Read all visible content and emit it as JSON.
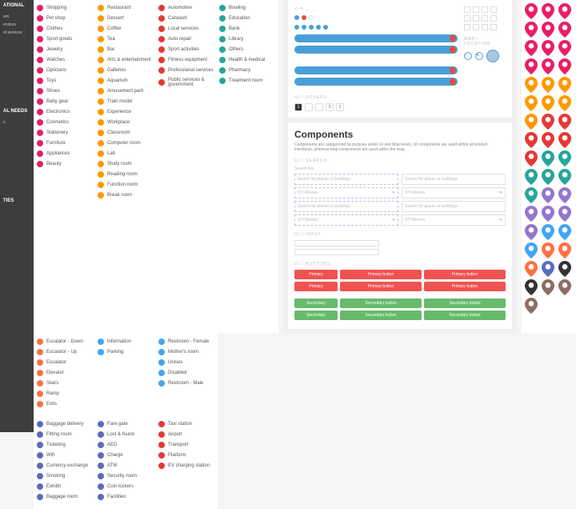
{
  "sidebar": [
    {
      "title": "ATIONAL",
      "items": [
        "ent",
        "ervices",
        "of services"
      ]
    },
    {
      "title": "AL NEEDS",
      "items": [
        "s"
      ]
    },
    {
      "title": "TIES",
      "items": [
        ""
      ]
    }
  ],
  "groups": [
    {
      "color": "#e91e63",
      "items": [
        "Shopping",
        "Pet shop",
        "Clothes",
        "Sport goods",
        "Jewelry",
        "Watches",
        "Opticians",
        "Toys",
        "Shoes",
        "Baby gear",
        "Electronics",
        "Cosmetics",
        "Stationery",
        "Furniture",
        "Appliances",
        "Beauty"
      ]
    },
    {
      "color": "#ff9800",
      "items": [
        "Restaurant",
        "Dessert",
        "Coffee",
        "Tea",
        "Bar",
        "Arts & entertainment",
        "Galleries",
        "Aquarium",
        "Amusement park",
        "Train model",
        "Experience",
        "Workplace",
        "Classroom",
        "Computer room",
        "Lab",
        "Study room",
        "Reading room",
        "Function room",
        "Break room"
      ]
    },
    {
      "color": "#e53935",
      "items": [
        "Automotive",
        "Carwash",
        "Local services",
        "Auto repair",
        "Sport activities",
        "Fitness equipment",
        "Professional services",
        "Public services & government"
      ]
    },
    {
      "color": "#26a69a",
      "items": [
        "Bowling",
        "Education",
        "Bank",
        "Library",
        "Others",
        "Health & medical",
        "Pharmacy",
        "Treatment room"
      ]
    }
  ],
  "needs": [
    {
      "color": "#ff7043",
      "items": [
        "Escalator - Down",
        "Escalator - Up",
        "Escalator",
        "Elevator",
        "Stairs",
        "Ramp",
        "Exits"
      ]
    },
    {
      "color": "#42a5f5",
      "items": [
        "Information",
        "Parking"
      ]
    },
    {
      "color": "#42a5f5",
      "items": [
        "Restroom - Female",
        "Mother's room",
        "Unisex",
        "Disabled",
        "Restroom - Male"
      ]
    }
  ],
  "facilities": [
    {
      "color": "#5c6bc0",
      "items": [
        "Baggage delivery",
        "Fitting room",
        "Ticketing",
        "Wifi",
        "Currency exchange",
        "Smoking",
        "Exhibit",
        "Baggage room"
      ]
    },
    {
      "color": "#5c6bc0",
      "items": [
        "Fare gate",
        "Lost & found",
        "AED",
        "Charge",
        "ATM",
        "Security room",
        "Coin lockers",
        "Facilities"
      ]
    },
    {
      "color": "#e53935",
      "items": [
        "Taxi station",
        "Airport",
        "Transport",
        "Platform",
        "EV charging station"
      ]
    }
  ],
  "map_label": "MAP / LOCATION",
  "others_label": "UI / OTHERS",
  "pages": [
    "1",
    "",
    "",
    "3",
    "2"
  ],
  "components": {
    "title": "Components",
    "desc": "Components are categorized by purpose under UI and Map levels. UI components are used within all product interfaces, whereas map components are used within the map."
  },
  "search": {
    "label": "UI / SEARCH",
    "sublabel": "Search bar",
    "ph1": "Search for places or buildings",
    "ph2": "STI Movers"
  },
  "input": {
    "label": "UI / INPUT"
  },
  "buttons": {
    "label": "UI / BUTTONS",
    "primary": "Primary",
    "primary_btn": "Primary button",
    "secondary": "Secondary",
    "secondary_btn": "Secondary button"
  },
  "pin_colors": [
    "#e91e63",
    "#e91e63",
    "#e91e63",
    "#e91e63",
    "#e91e63",
    "#e91e63",
    "#e91e63",
    "#e91e63",
    "#e91e63",
    "#e91e63",
    "#e91e63",
    "#e91e63",
    "#ff9800",
    "#ff9800",
    "#ff9800",
    "#ff9800",
    "#ff9800",
    "#ff9800",
    "#ff9800",
    "#e53935",
    "#e53935",
    "#e53935",
    "#e53935",
    "#e53935",
    "#e53935",
    "#26a69a",
    "#26a69a",
    "#26a69a",
    "#26a69a",
    "#26a69a",
    "#26a69a",
    "#9575cd",
    "#9575cd",
    "#9575cd",
    "#9575cd",
    "#9575cd",
    "#9575cd",
    "#42a5f5",
    "#42a5f5",
    "#42a5f5",
    "#ff7043",
    "#ff7043",
    "#ff7043",
    "#5c6bc0",
    "#333",
    "#333",
    "#8d6e63",
    "#8d6e63",
    "#8d6e63"
  ]
}
